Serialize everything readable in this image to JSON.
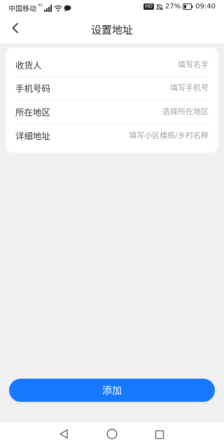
{
  "status_bar": {
    "carrier": "中国移动",
    "network_type": "⁴ᴳ",
    "hd_badge": "HD",
    "battery_percent": "27%",
    "time": "09:40",
    "icons": [
      "signal-icon",
      "wifi-icon",
      "message-icon",
      "mute-icon",
      "battery-icon"
    ]
  },
  "header": {
    "title": "设置地址",
    "back_icon": "chevron-left-icon"
  },
  "form": {
    "rows": [
      {
        "label": "收货人",
        "placeholder": "填写名字"
      },
      {
        "label": "手机号码",
        "placeholder": "填写手机号"
      },
      {
        "label": "所在地区",
        "placeholder": "选择所在地区"
      },
      {
        "label": "详细地址",
        "placeholder": "填写小区楼栋/乡村名称"
      }
    ]
  },
  "add_button": {
    "label": "添加"
  },
  "nav_bar": {
    "icons": [
      "back-triangle-icon",
      "home-circle-icon",
      "recents-square-icon"
    ]
  },
  "colors": {
    "primary": "#1677ff",
    "background": "#f0f0f0",
    "card": "#ffffff",
    "placeholder": "#a0a0a0"
  }
}
